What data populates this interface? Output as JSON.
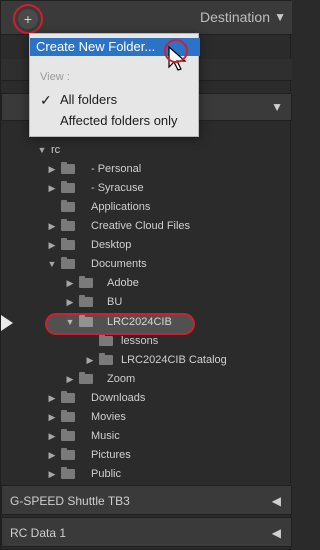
{
  "header": {
    "plus_symbol": "+",
    "title": "Destination",
    "caret": "▼"
  },
  "menu": {
    "create_new_folder": "Create New Folder...",
    "view_label": "View :",
    "all_folders_check": "✓",
    "all_folders": "All folders",
    "affected_only": "Affected folders only"
  },
  "top_drive": {
    "meta": "",
    "caret": "▼"
  },
  "tree": [
    {
      "label": "rc",
      "triangle": "▼"
    },
    {
      "label": "- Personal",
      "triangle": "▶"
    },
    {
      "label": "- Syracuse",
      "triangle": "▶"
    },
    {
      "label": "Applications",
      "triangle": ""
    },
    {
      "label": "Creative Cloud Files",
      "triangle": "▶"
    },
    {
      "label": "Desktop",
      "triangle": "▶"
    },
    {
      "label": "Documents",
      "triangle": "▼"
    },
    {
      "label": "Adobe",
      "triangle": "▶"
    },
    {
      "label": "BU",
      "triangle": "▶"
    },
    {
      "label": "LRC2024CIB",
      "triangle": "▼"
    },
    {
      "label": "lessons",
      "triangle": ""
    },
    {
      "label": "LRC2024CIB Catalog",
      "triangle": "▶"
    },
    {
      "label": "Zoom",
      "triangle": "▶"
    },
    {
      "label": "Downloads",
      "triangle": "▶"
    },
    {
      "label": "Movies",
      "triangle": "▶"
    },
    {
      "label": "Music",
      "triangle": "▶"
    },
    {
      "label": "Pictures",
      "triangle": "▶"
    },
    {
      "label": "Public",
      "triangle": "▶"
    }
  ],
  "drives": [
    {
      "name": "G-SPEED Shuttle TB3",
      "meta": "",
      "caret": "◀"
    },
    {
      "name": "RC Data 1",
      "meta": "",
      "caret": "◀"
    }
  ],
  "colors": {
    "highlight_blue": "#2a73c7",
    "annotation_red": "#d11f2f"
  }
}
